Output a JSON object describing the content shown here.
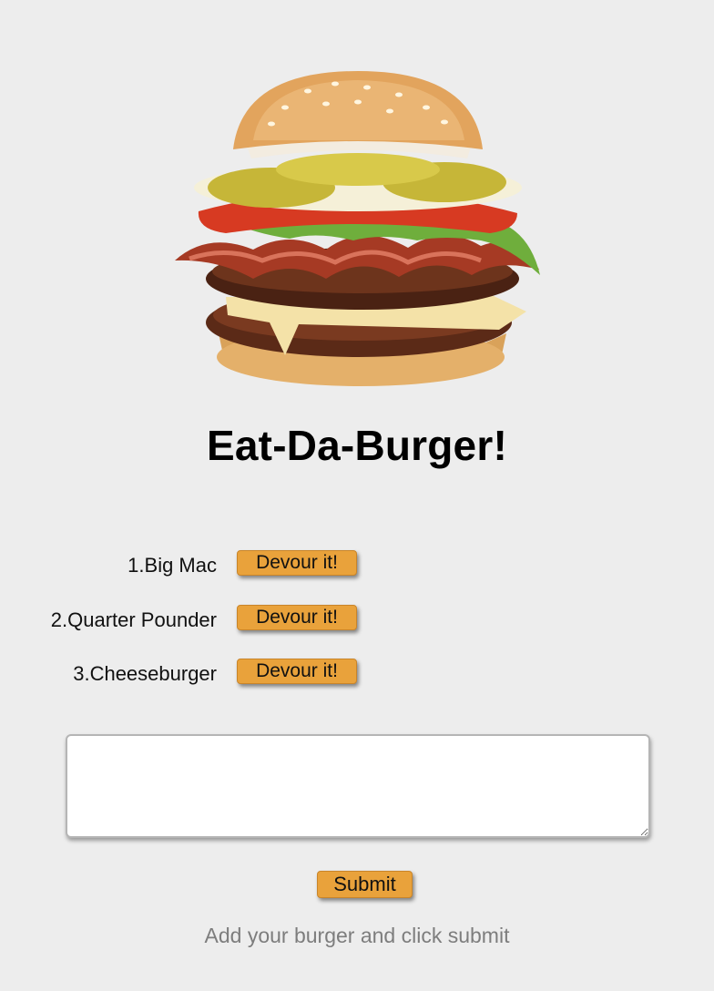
{
  "header": {
    "hero_image": "burger-image",
    "title": "Eat-Da-Burger!"
  },
  "burgers": [
    {
      "label": "1.Big Mac",
      "button": "Devour it!"
    },
    {
      "label": "2.Quarter Pounder",
      "button": "Devour it!"
    },
    {
      "label": "3.Cheeseburger",
      "button": "Devour it!"
    }
  ],
  "form": {
    "input_value": "",
    "submit_label": "Submit",
    "hint": "Add your burger and click submit"
  },
  "colors": {
    "background": "#ededed",
    "button": "#e9a23b",
    "hint_text": "#7d7d7d"
  }
}
